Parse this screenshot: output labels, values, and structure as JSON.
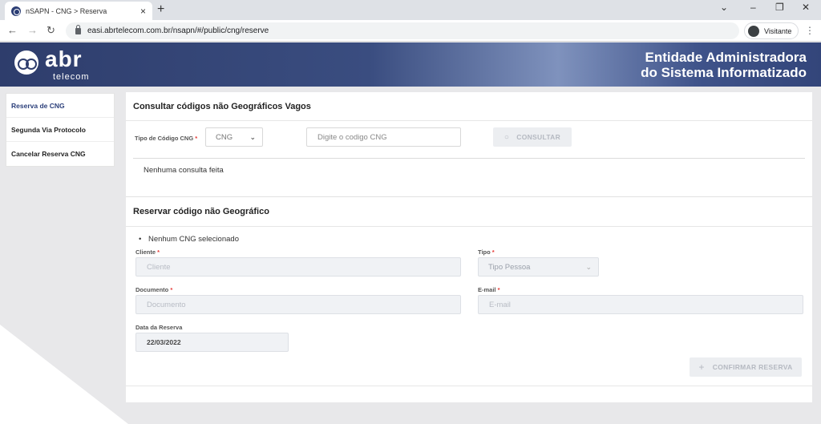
{
  "browser": {
    "tab_title": "nSAPN - CNG > Reserva",
    "tab_close": "×",
    "new_tab": "+",
    "url": "easi.abrtelecom.com.br/nsapn/#/public/cng/reserve",
    "profile_label": "Visitante",
    "controls": {
      "chevron": "⌄",
      "minimize": "–",
      "maximize": "❐",
      "close": "✕"
    },
    "nav": {
      "back": "←",
      "forward": "→",
      "reload": "↻",
      "menu": "⋮"
    }
  },
  "header": {
    "logo_text": "abr",
    "logo_sub": "telecom",
    "entity_line1": "Entidade Administradora",
    "entity_line2": "do Sistema Informatizado",
    "gradient_colors": [
      "#2e3d6c",
      "#7f92bd"
    ]
  },
  "sidebar": {
    "items": [
      {
        "label": "Reserva de CNG",
        "active": true
      },
      {
        "label": "Segunda Via Protocolo",
        "active": false
      },
      {
        "label": "Cancelar Reserva CNG",
        "active": false
      }
    ]
  },
  "consult": {
    "title": "Consultar códigos não Geográficos Vagos",
    "type_label": "Tipo de Código CNG",
    "required_mark": "*",
    "type_value": "CNG",
    "code_placeholder": "Digite o codigo CNG",
    "button_label": "CONSULTAR",
    "button_icon": "search-icon",
    "empty_message": "Nenhuma consulta feita"
  },
  "reserve": {
    "title": "Reservar código não Geográfico",
    "bullet_text": "Nenhum CNG selecionado",
    "cliente_label": "Cliente",
    "cliente_placeholder": "Cliente",
    "tipo_label": "Tipo",
    "tipo_value": "Tipo Pessoa",
    "documento_label": "Documento",
    "documento_placeholder": "Documento",
    "email_label": "E-mail",
    "email_placeholder": "E-mail",
    "data_label": "Data da Reserva",
    "data_value": "22/03/2022",
    "confirm_label": "CONFIRMAR RESERVA",
    "confirm_icon": "plus-icon"
  },
  "colors": {
    "accent": "#2b3f7a",
    "required": "#e53935",
    "disabled_bg": "#eceef1"
  }
}
